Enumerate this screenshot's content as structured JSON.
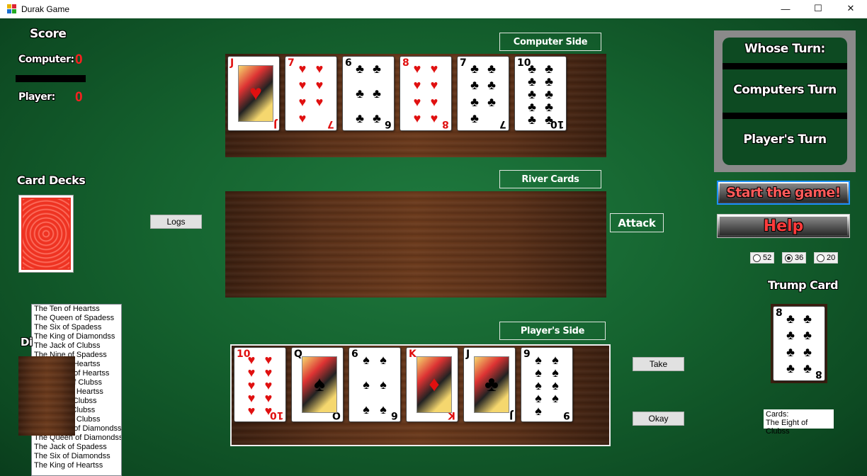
{
  "window": {
    "title": "Durak Game",
    "minimize": "—",
    "maximize": "☐",
    "close": "✕"
  },
  "score": {
    "heading": "Score",
    "computer_label": "Computer:",
    "computer_value": "0",
    "player_label": "Player:",
    "player_value": "0"
  },
  "labels": {
    "computer_side": "Computer Side",
    "river_cards": "River Cards",
    "players_side": "Player's Side",
    "card_decks": "Card Decks",
    "trump_card": "Trump Card",
    "discard_partial": "Di"
  },
  "buttons": {
    "logs": "Logs",
    "attack": "Attack",
    "take": "Take",
    "okay": "Okay",
    "start": "Start the game!",
    "help": "Help"
  },
  "turn": {
    "heading": "Whose Turn:",
    "computer": "Computers Turn",
    "player": "Player's Turn"
  },
  "deck_options": [
    {
      "label": "52",
      "selected": false
    },
    {
      "label": "36",
      "selected": true
    },
    {
      "label": "20",
      "selected": false
    }
  ],
  "computer_hand": [
    {
      "rank": "J",
      "suit": "♥",
      "color": "red",
      "face": true
    },
    {
      "rank": "7",
      "suit": "♥",
      "color": "red",
      "face": false
    },
    {
      "rank": "6",
      "suit": "♣",
      "color": "black",
      "face": false
    },
    {
      "rank": "8",
      "suit": "♥",
      "color": "red",
      "face": false
    },
    {
      "rank": "7",
      "suit": "♣",
      "color": "black",
      "face": false
    },
    {
      "rank": "10",
      "suit": "♣",
      "color": "black",
      "face": false
    }
  ],
  "player_hand": [
    {
      "rank": "10",
      "suit": "♥",
      "color": "red",
      "face": false
    },
    {
      "rank": "Q",
      "suit": "♠",
      "color": "black",
      "face": true
    },
    {
      "rank": "6",
      "suit": "♠",
      "color": "black",
      "face": false
    },
    {
      "rank": "K",
      "suit": "♦",
      "color": "red",
      "face": true
    },
    {
      "rank": "J",
      "suit": "♣",
      "color": "black",
      "face": true
    },
    {
      "rank": "9",
      "suit": "♠",
      "color": "black",
      "face": false
    }
  ],
  "trump": {
    "rank": "8",
    "suit": "♣",
    "color": "black",
    "face": false
  },
  "cards_info": {
    "line1": "Cards:",
    "line2": "The Eight of Clubss"
  },
  "log_list": [
    "The Ten of Heartss",
    "The Queen of Spadess",
    "The Six of Spadess",
    "The King of Diamondss",
    "The Jack of Clubss",
    "The Nine of Spadess",
    "The Ace of Heartss",
    "The Seven of Heartss",
    "The Eight of Clubss",
    "The Jack of Heartss",
    "The Ten of Clubss",
    "The Six of Clubss",
    "The Nine of Clubss",
    "The Seven of Diamondss",
    "The Queen of Diamondss",
    "The Jack of Spadess",
    "The Six of Diamondss",
    "The King of Heartss"
  ],
  "colors": {
    "felt": "#15632f",
    "score_red": "#ff2020",
    "start_text": "#ff5a5a",
    "help_text": "#ff3b3b"
  }
}
